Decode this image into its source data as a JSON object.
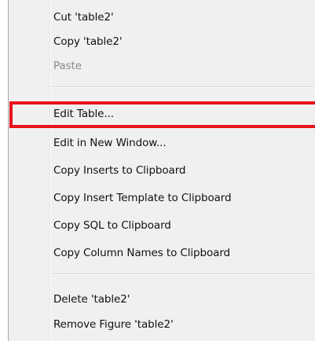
{
  "context_menu": {
    "items": [
      {
        "label": "Cut 'table2'",
        "enabled": true
      },
      {
        "label": "Copy 'table2'",
        "enabled": true
      },
      {
        "label": "Paste",
        "enabled": false
      },
      {
        "label": "Edit Table...",
        "enabled": true,
        "highlighted": true
      },
      {
        "label": "Edit in New Window...",
        "enabled": true
      },
      {
        "label": "Copy Inserts to Clipboard",
        "enabled": true
      },
      {
        "label": "Copy Insert Template to Clipboard",
        "enabled": true
      },
      {
        "label": "Copy SQL to Clipboard",
        "enabled": true
      },
      {
        "label": "Copy Column Names to Clipboard",
        "enabled": true
      },
      {
        "label": "Delete 'table2'",
        "enabled": true
      },
      {
        "label": "Remove Figure 'table2'",
        "enabled": true
      }
    ]
  },
  "colors": {
    "menu_background": "#f0f0f0",
    "highlight_outline": "#e8131c",
    "disabled_text": "#8a8a8a"
  }
}
